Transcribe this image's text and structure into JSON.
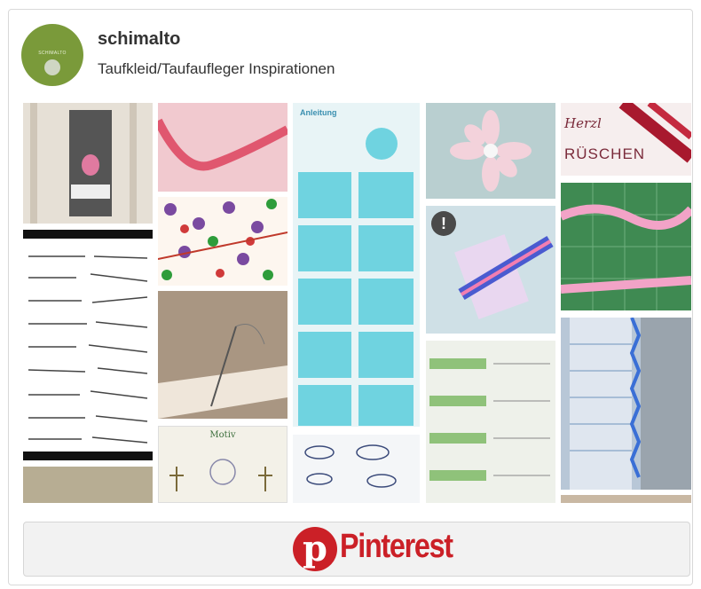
{
  "profile": {
    "username": "schimalto",
    "board_title": "Taufkleid/Taufaufleger Inspirationen",
    "avatar_text": "SCHIMALTO"
  },
  "pins": [
    {
      "name": "pin-candle-owl",
      "color": "#d9d2c8"
    },
    {
      "name": "pin-pattern-sheet",
      "color": "#eeeeee"
    },
    {
      "name": "pin-fabric-bottom",
      "color": "#b7ad93"
    },
    {
      "name": "pin-pink-ribbon-twist",
      "color": "#f1c9cf"
    },
    {
      "name": "pin-polka-fabric",
      "color": "#6b5b7a"
    },
    {
      "name": "pin-lace-needle",
      "color": "#c4b2a0"
    },
    {
      "name": "pin-baptism-pattern",
      "color": "#f3f1e8"
    },
    {
      "name": "pin-ribbon-flower-tutorial",
      "color": "#cbe9ee"
    },
    {
      "name": "pin-fish-pattern",
      "color": "#e8edf2"
    },
    {
      "name": "pin-satin-flower",
      "color": "#b9cfd0"
    },
    {
      "name": "pin-rickrack-trim",
      "color": "#cfe0e6"
    },
    {
      "name": "pin-green-lace",
      "color": "#d7e3c9"
    },
    {
      "name": "pin-herzl-ruschen",
      "color": "#f0e3e3"
    },
    {
      "name": "pin-cutting-mat",
      "color": "#3f8a52"
    },
    {
      "name": "pin-sewing-machine",
      "color": "#b8c7d7"
    }
  ],
  "texts": {
    "herzl_word1": "Herzl",
    "herzl_word2": "RÜSCHEN",
    "tutorial_header": "Anleitung",
    "pattern_title": "Motiv",
    "alert_symbol": "!"
  },
  "footer": {
    "brand": "Pinterest",
    "logo_letter": "p"
  }
}
